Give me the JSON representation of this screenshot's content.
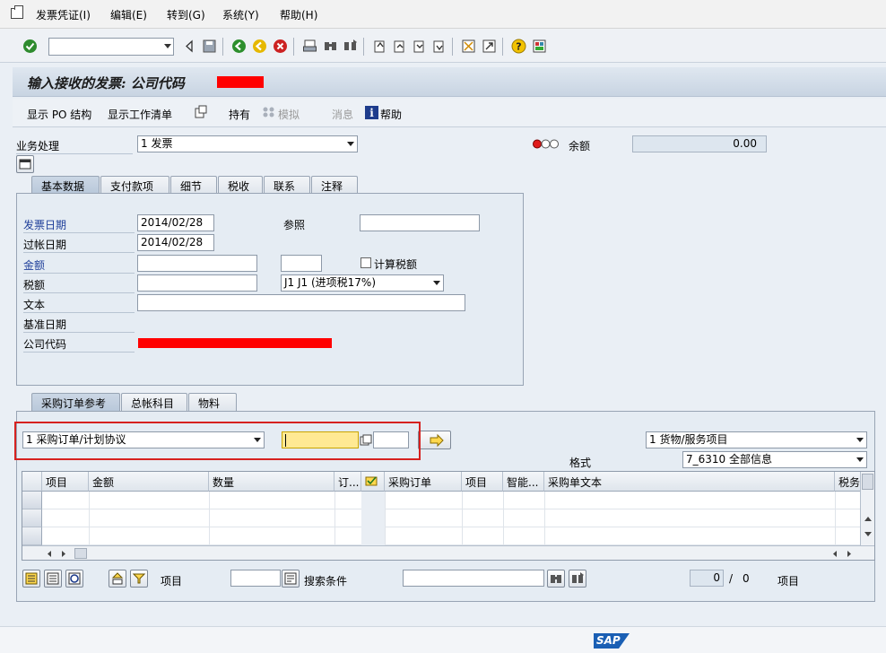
{
  "menu": [
    "发票凭证(I)",
    "编辑(E)",
    "转到(G)",
    "系统(Y)",
    "帮助(H)"
  ],
  "title": "输入接收的发票: 公司代码",
  "app_toolbar": {
    "po_structure": "显示 PO 结构",
    "worklist": "显示工作清单",
    "hold": "持有",
    "simulate": "模拟",
    "messages": "消息",
    "help": "帮助"
  },
  "header": {
    "transaction_label": "业务处理",
    "transaction_value": "1 发票",
    "balance_label": "余额",
    "balance_value": "0.00"
  },
  "top_tabs": [
    "基本数据",
    "支付款项",
    "细节",
    "税收",
    "联系",
    "注释"
  ],
  "basic": {
    "invoice_date_label": "发票日期",
    "invoice_date": "2014/02/28",
    "posting_date_label": "过帐日期",
    "posting_date": "2014/02/28",
    "reference_label": "参照",
    "amount_label": "金额",
    "calc_tax_label": "计算税额",
    "tax_label": "税额",
    "tax_code": "J1 J1 (进项税17%)",
    "text_label": "文本",
    "baseline_label": "基准日期",
    "company_label": "公司代码"
  },
  "bottom_tabs": [
    "采购订单参考",
    "总帐科目",
    "物料"
  ],
  "po_ref": {
    "ref_type": "1 采购订单/计划协议",
    "item_type": "1 货物/服务项目",
    "layout_label": "格式",
    "layout_value": "7_6310 全部信息"
  },
  "grid": {
    "columns": [
      "项目",
      "金额",
      "数量",
      "订...",
      "",
      "采购订单",
      "项目",
      "智能...",
      "采购单文本",
      "税务"
    ]
  },
  "footer": {
    "item_label": "项目",
    "search_label": "搜索条件",
    "count_current": "0",
    "count_sep": "/",
    "count_total": "0",
    "items_label": "项目"
  },
  "sap_logo": "SAP",
  "colors": {
    "accent": "#1f3f9a",
    "highlight": "#ffe993",
    "redact": "#ff0000",
    "frame": "#d6211f"
  }
}
